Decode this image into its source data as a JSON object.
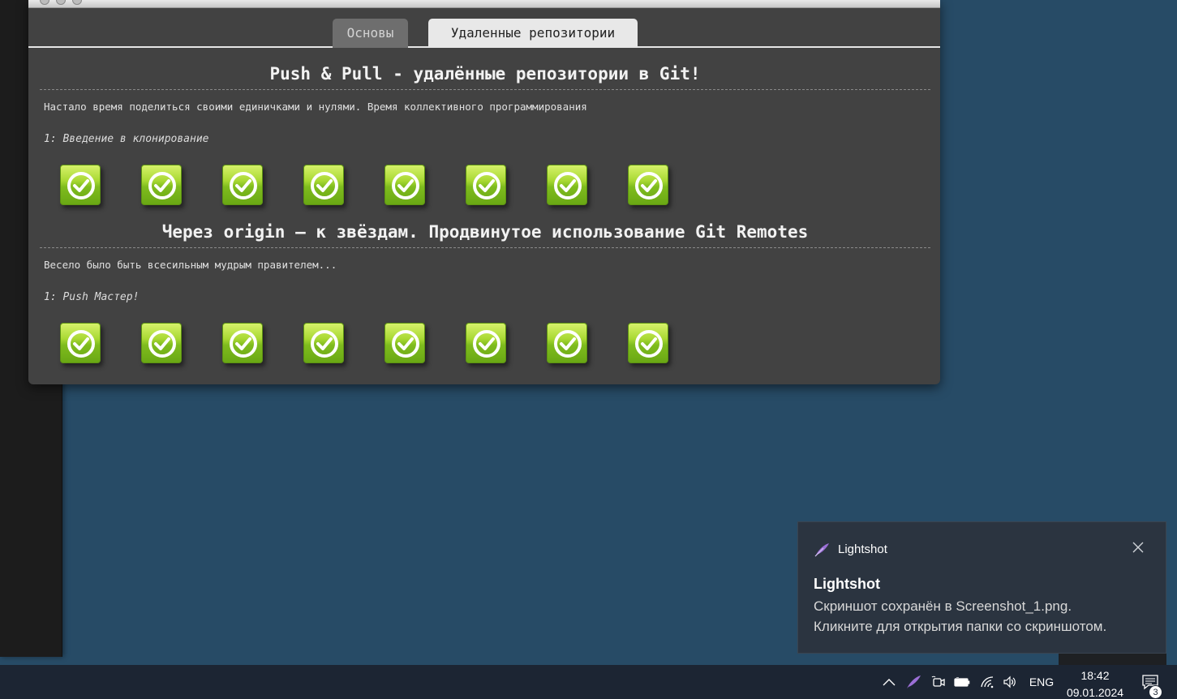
{
  "tabs": [
    {
      "label": "Основы",
      "active": false
    },
    {
      "label": "Удаленные репозитории",
      "active": true
    }
  ],
  "sections": [
    {
      "title": "Push & Pull - удалённые репозитории в Git!",
      "description": "Настало время поделиться своими единичками и нулями. Время коллективного программирования",
      "level_label": "1: Введение в клонирование",
      "levels_completed": [
        true,
        true,
        true,
        true,
        true,
        true,
        true,
        true
      ]
    },
    {
      "title": "Через origin – к звёздам. Продвинутое использование Git Remotes",
      "description": "Весело было быть всесильным мудрым правителем...",
      "level_label": "1: Push Мастер!",
      "levels_completed": [
        true,
        true,
        true,
        true,
        true,
        true,
        true,
        true
      ]
    }
  ],
  "notification": {
    "app_name": "Lightshot",
    "title": "Lightshot",
    "body_line1": "Скриншот сохранён в Screenshot_1.png.",
    "body_line2": "Кликните для открытия папки со скриншотом."
  },
  "taskbar": {
    "language": "ENG",
    "time": "18:42",
    "date": "09.01.2024",
    "notification_count": "3"
  },
  "colors": {
    "desktop": "#274b66",
    "modal": "#424242",
    "level_complete": "#7fbc1e",
    "toast": "#2b3440",
    "taskbar": "#1c2533"
  }
}
